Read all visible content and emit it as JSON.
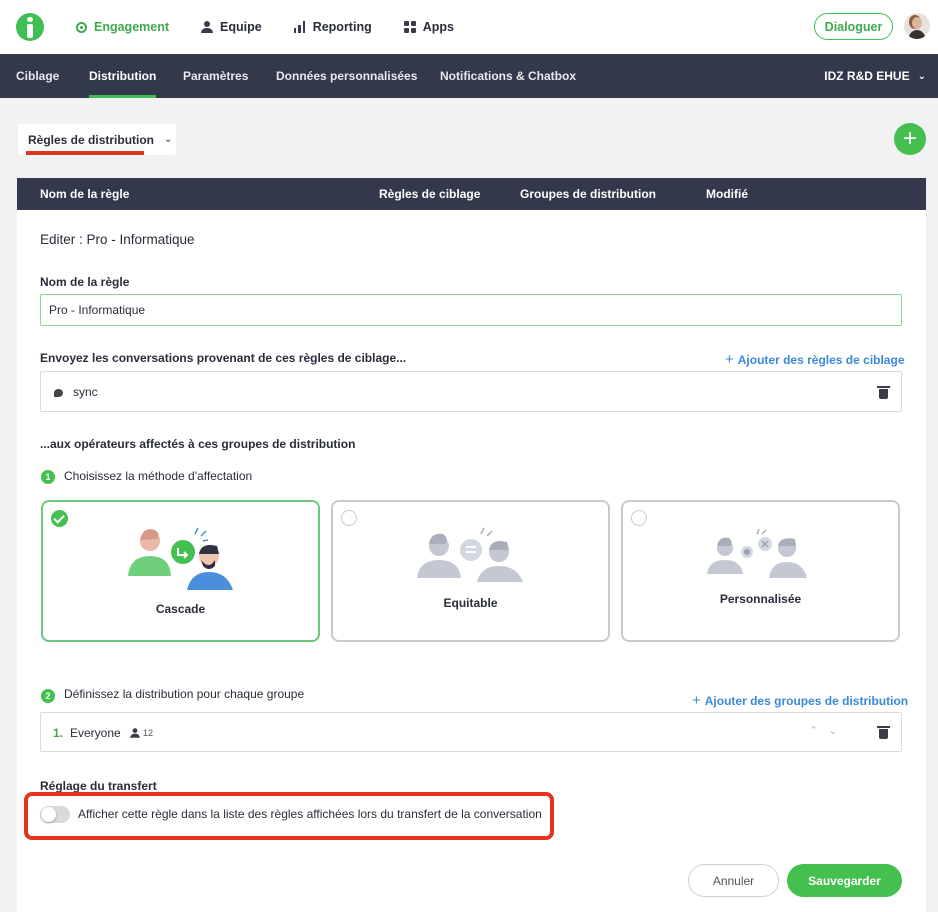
{
  "topnav": {
    "items": [
      {
        "label": "Engagement",
        "icon": "target-icon",
        "active": true
      },
      {
        "label": "Equipe",
        "icon": "person-icon"
      },
      {
        "label": "Reporting",
        "icon": "bar-chart-icon"
      },
      {
        "label": "Apps",
        "icon": "grid-icon"
      }
    ],
    "dialog_label": "Dialoguer"
  },
  "subnav": {
    "tabs": [
      {
        "label": "Ciblage"
      },
      {
        "label": "Distribution",
        "active": true
      },
      {
        "label": "Paramètres"
      },
      {
        "label": "Données personnalisées"
      },
      {
        "label": "Notifications & Chatbox"
      }
    ],
    "org": "IDZ R&D EHUE"
  },
  "dropdown": {
    "label": "Règles de distribution"
  },
  "table": {
    "headers": [
      "Nom de la règle",
      "Règles de ciblage",
      "Groupes de distribution",
      "Modifié"
    ]
  },
  "form": {
    "edit_title": "Editer : Pro - Informatique",
    "name_label": "Nom de la règle",
    "name_value": "Pro - Informatique",
    "targeting_label": "Envoyez les conversations provenant de ces règles de ciblage...",
    "add_targeting": "Ajouter des règles de ciblage",
    "targeting_item": "sync",
    "operators_label": "...aux opérateurs affectés à ces groupes de distribution",
    "step1_num": "1",
    "step1_label": "Choisissez la méthode d'affectation",
    "methods": [
      {
        "label": "Cascade",
        "selected": true
      },
      {
        "label": "Equitable",
        "selected": false
      },
      {
        "label": "Personnalisée",
        "selected": false
      }
    ],
    "step2_num": "2",
    "step2_label": "Définissez la distribution pour chaque groupe",
    "add_groups": "Ajouter des groupes de distribution",
    "group": {
      "index": "1.",
      "name": "Everyone",
      "count": "12"
    },
    "transfer_label": "Réglage du transfert",
    "transfer_toggle_label": "Afficher cette règle dans la liste des règles affichées lors du transfert de la conversation",
    "transfer_enabled": false,
    "cancel_label": "Annuler",
    "save_label": "Sauvegarder"
  },
  "colors": {
    "accent": "#43c04f",
    "nav": "#33384a",
    "link": "#3b8ad9",
    "highlight": "#e1341e"
  }
}
